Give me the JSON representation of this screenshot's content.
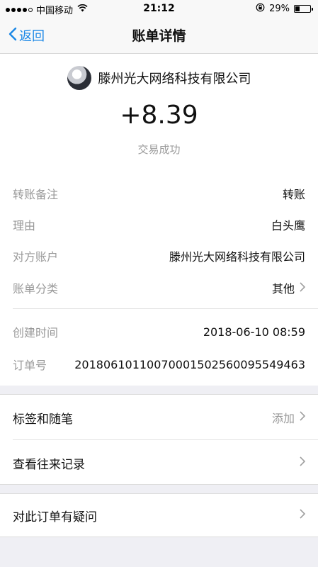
{
  "status_bar": {
    "carrier": "中国移动",
    "time": "21:12",
    "battery": "29%",
    "battery_level": 0.29
  },
  "nav": {
    "back_label": "返回",
    "title": "账单详情"
  },
  "transaction": {
    "merchant": "滕州光大网络科技有限公司",
    "amount": "+8.39",
    "status": "交易成功"
  },
  "details": {
    "note_label": "转账备注",
    "note_value": "转账",
    "reason_label": "理由",
    "reason_value": "白头鹰",
    "counterparty_label": "对方账户",
    "counterparty_value": "滕州光大网络科技有限公司",
    "category_label": "账单分类",
    "category_value": "其他",
    "created_label": "创建时间",
    "created_value": "2018-06-10 08:59",
    "order_label": "订单号",
    "order_value": "20180610110070001502560095549463"
  },
  "actions": {
    "tags_label": "标签和随笔",
    "tags_hint": "添加",
    "history_label": "查看往来记录",
    "question_label": "对此订单有疑问"
  }
}
